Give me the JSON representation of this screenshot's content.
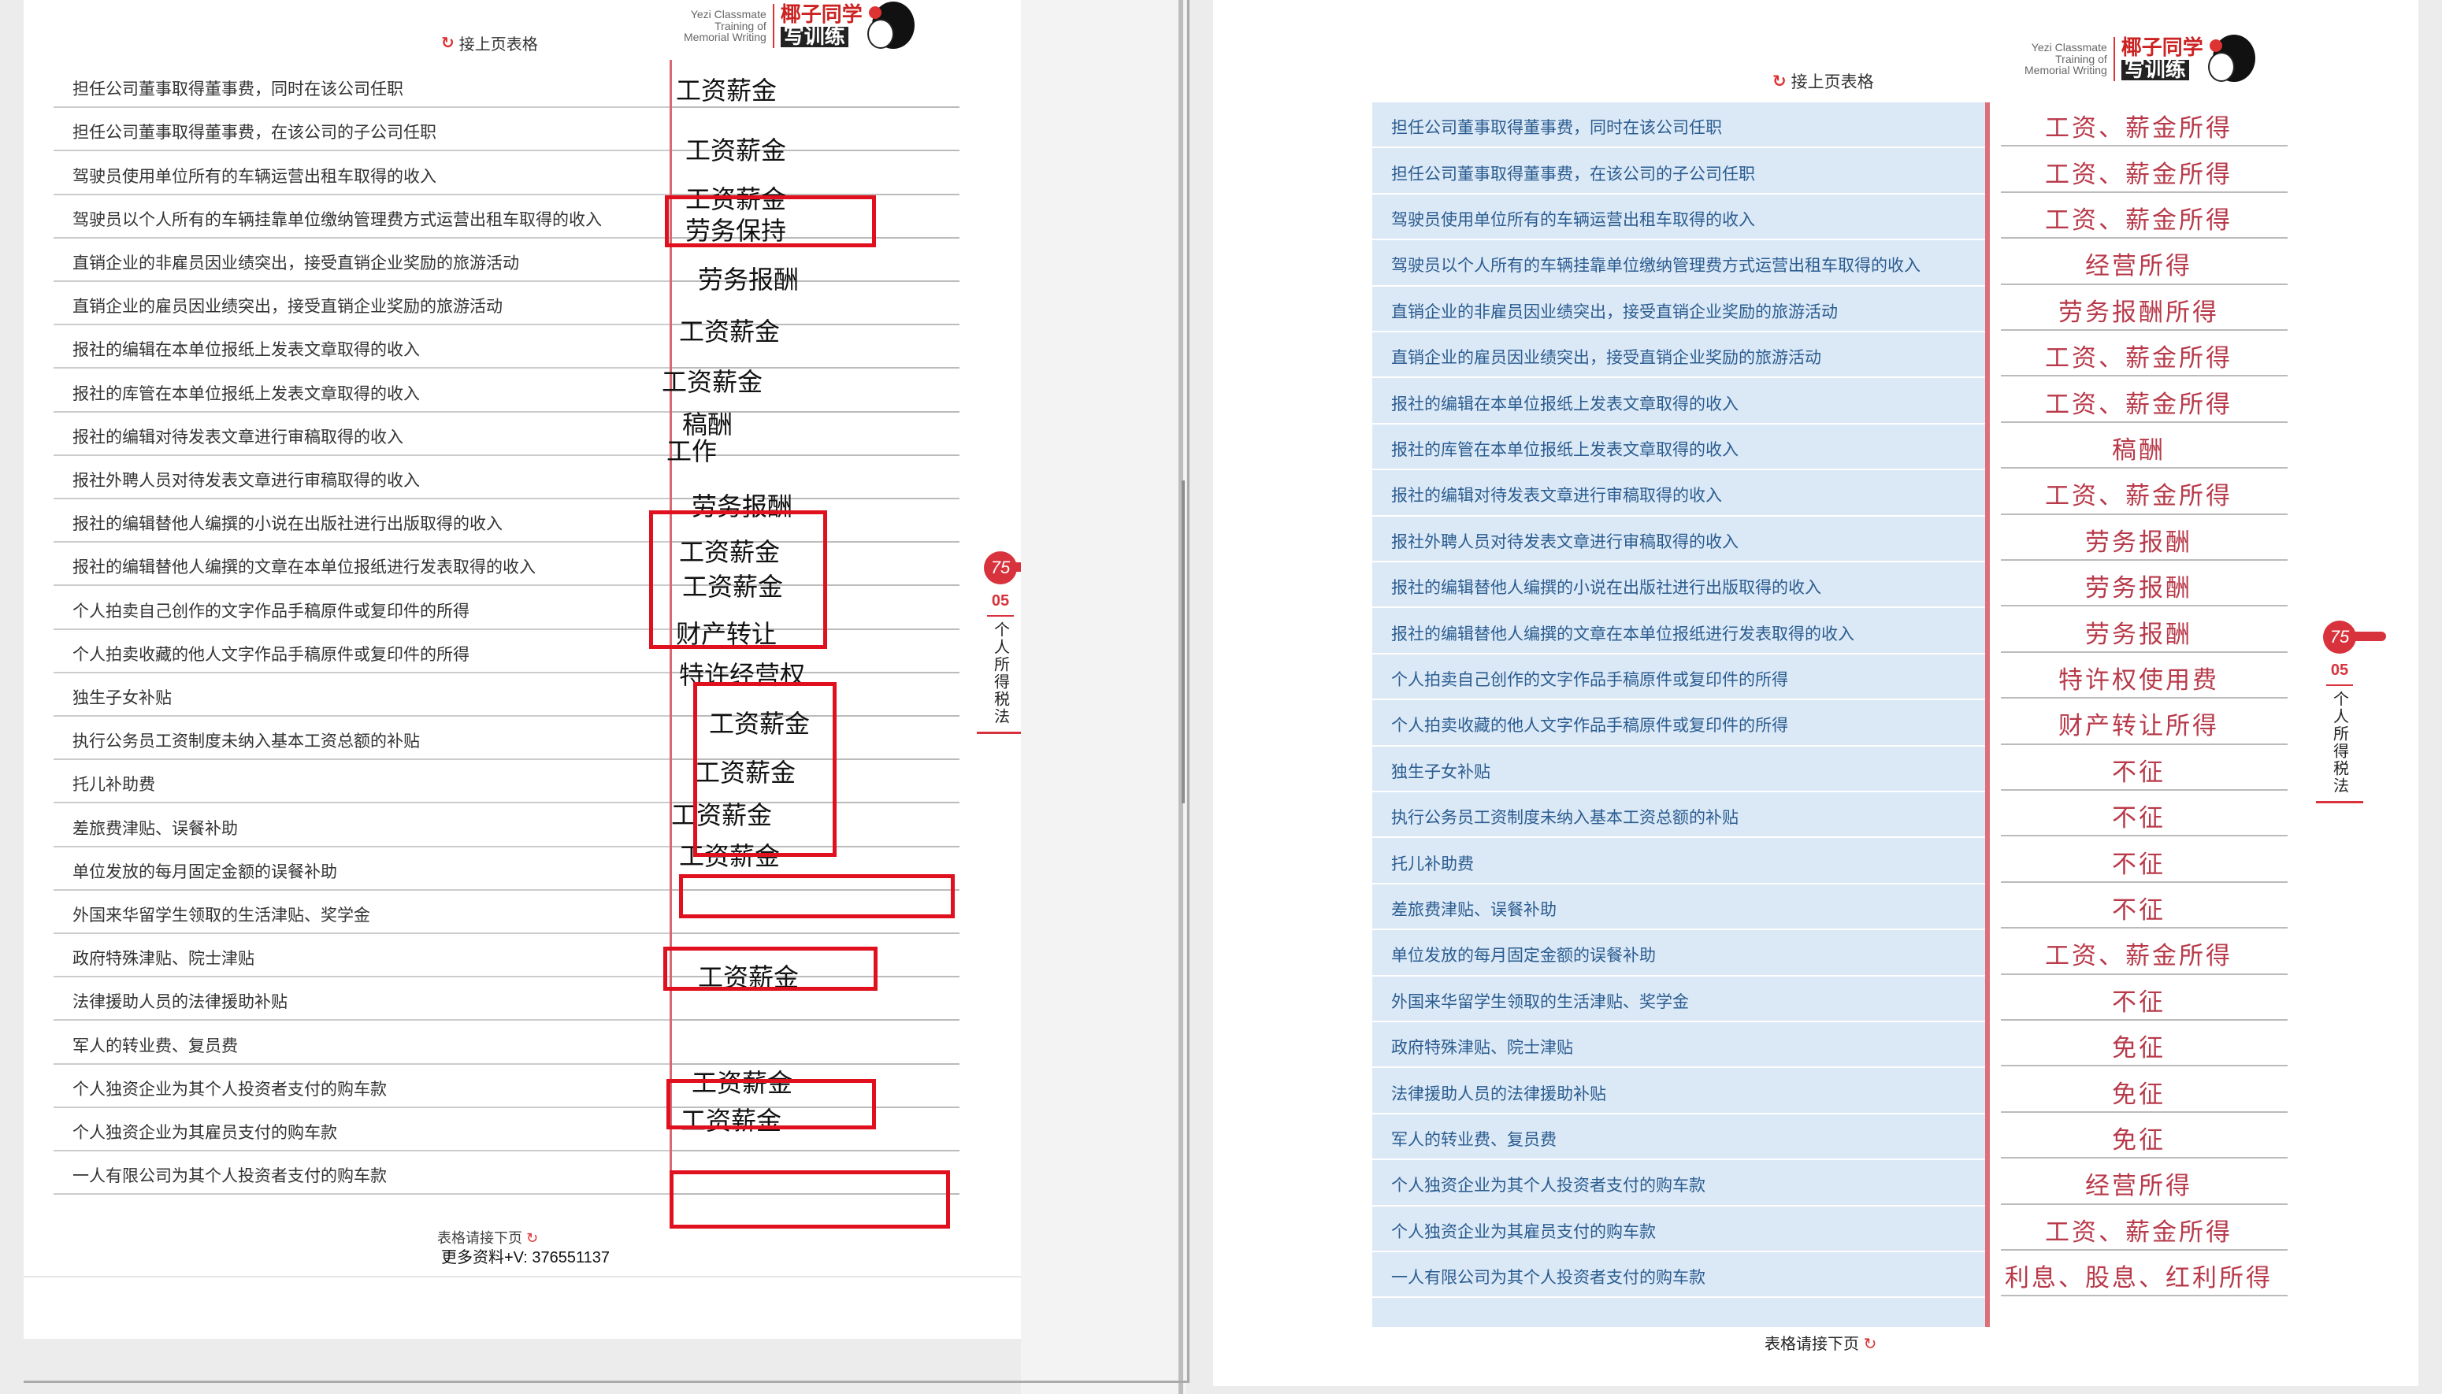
{
  "left": {
    "brand": {
      "en_lines": [
        "Yezi Classmate",
        "Training of",
        "Memorial Writing"
      ],
      "cn_line1": "椰子同学",
      "cn_line2": "写训练"
    },
    "continue_label": "接上页表格",
    "rows": [
      "担任公司董事取得董事费，同时在该公司任职",
      "担任公司董事取得董事费，在该公司的子公司任职",
      "驾驶员使用单位所有的车辆运营出租车取得的收入",
      "驾驶员以个人所有的车辆挂靠单位缴纳管理费方式运营出租车取得的收入",
      "直销企业的非雇员因业绩突出，接受直销企业奖励的旅游活动",
      "直销企业的雇员因业绩突出，接受直销企业奖励的旅游活动",
      "报社的编辑在本单位报纸上发表文章取得的收入",
      "报社的库管在本单位报纸上发表文章取得的收入",
      "报社的编辑对待发表文章进行审稿取得的收入",
      "报社外聘人员对待发表文章进行审稿取得的收入",
      "报社的编辑替他人编撰的小说在出版社进行出版取得的收入",
      "报社的编辑替他人编撰的文章在本单位报纸进行发表取得的收入",
      "个人拍卖自己创作的文字作品手稿原件或复印件的所得",
      "个人拍卖收藏的他人文字作品手稿原件或复印件的所得",
      "独生子女补贴",
      "执行公务员工资制度未纳入基本工资总额的补贴",
      "托儿补助费",
      "差旅费津贴、误餐补助",
      "单位发放的每月固定金额的误餐补助",
      "外国来华留学生领取的生活津贴、奖学金",
      "政府特殊津贴、院士津贴",
      "法律援助人员的法律援助补贴",
      "军人的转业费、复员费",
      "个人独资企业为其个人投资者支付的购车款",
      "个人独资企业为其雇员支付的购车款",
      "一人有限公司为其个人投资者支付的购车款"
    ],
    "answers": [
      "工资薪金",
      "工资薪金",
      "工资薪金",
      "劳务保持",
      "劳务报酬",
      "工资薪金",
      "工资薪金",
      "稿酬",
      "工作",
      "劳务报酬",
      "工资薪金",
      "工资薪金",
      "财产转让",
      "特许经营权",
      "工资薪金",
      "工资薪金",
      "工资薪金",
      "工资薪金",
      "工资薪金",
      "工资薪金",
      "工资薪金"
    ],
    "tab": {
      "page_num": "75",
      "chapter": "05",
      "title": "个人所得税法"
    },
    "footer_next": "表格请接下页",
    "footer_contact": "更多资料+V: 376551137"
  },
  "right": {
    "brand": {
      "en_lines": [
        "Yezi Classmate",
        "Training of",
        "Memorial Writing"
      ],
      "cn_line1": "椰子同学",
      "cn_line2": "写训练"
    },
    "continue_label": "接上页表格",
    "rows": [
      {
        "desc": "担任公司董事取得董事费，同时在该公司任职",
        "answer": "工资、薪金所得"
      },
      {
        "desc": "担任公司董事取得董事费，在该公司的子公司任职",
        "answer": "工资、薪金所得"
      },
      {
        "desc": "驾驶员使用单位所有的车辆运营出租车取得的收入",
        "answer": "工资、薪金所得"
      },
      {
        "desc": "驾驶员以个人所有的车辆挂靠单位缴纳管理费方式运营出租车取得的收入",
        "answer": "经营所得"
      },
      {
        "desc": "直销企业的非雇员因业绩突出，接受直销企业奖励的旅游活动",
        "answer": "劳务报酬所得"
      },
      {
        "desc": "直销企业的雇员因业绩突出，接受直销企业奖励的旅游活动",
        "answer": "工资、薪金所得"
      },
      {
        "desc": "报社的编辑在本单位报纸上发表文章取得的收入",
        "answer": "工资、薪金所得"
      },
      {
        "desc": "报社的库管在本单位报纸上发表文章取得的收入",
        "answer": "稿酬"
      },
      {
        "desc": "报社的编辑对待发表文章进行审稿取得的收入",
        "answer": "工资、薪金所得"
      },
      {
        "desc": "报社外聘人员对待发表文章进行审稿取得的收入",
        "answer": "劳务报酬"
      },
      {
        "desc": "报社的编辑替他人编撰的小说在出版社进行出版取得的收入",
        "answer": "劳务报酬"
      },
      {
        "desc": "报社的编辑替他人编撰的文章在本单位报纸进行发表取得的收入",
        "answer": "劳务报酬"
      },
      {
        "desc": "个人拍卖自己创作的文字作品手稿原件或复印件的所得",
        "answer": "特许权使用费"
      },
      {
        "desc": "个人拍卖收藏的他人文字作品手稿原件或复印件的所得",
        "answer": "财产转让所得"
      },
      {
        "desc": "独生子女补贴",
        "answer": "不征"
      },
      {
        "desc": "执行公务员工资制度未纳入基本工资总额的补贴",
        "answer": "不征"
      },
      {
        "desc": "托儿补助费",
        "answer": "不征"
      },
      {
        "desc": "差旅费津贴、误餐补助",
        "answer": "不征"
      },
      {
        "desc": "单位发放的每月固定金额的误餐补助",
        "answer": "工资、薪金所得"
      },
      {
        "desc": "外国来华留学生领取的生活津贴、奖学金",
        "answer": "不征"
      },
      {
        "desc": "政府特殊津贴、院士津贴",
        "answer": "免征"
      },
      {
        "desc": "法律援助人员的法律援助补贴",
        "answer": "免征"
      },
      {
        "desc": "军人的转业费、复员费",
        "answer": "免征"
      },
      {
        "desc": "个人独资企业为其个人投资者支付的购车款",
        "answer": "经营所得"
      },
      {
        "desc": "个人独资企业为其雇员支付的购车款",
        "answer": "工资、薪金所得"
      },
      {
        "desc": "一人有限公司为其个人投资者支付的购车款",
        "answer": "利息、股息、红利所得"
      }
    ],
    "tab": {
      "page_num": "75",
      "chapter": "05",
      "title": "个人所得税法"
    },
    "footer_next": "表格请接下页"
  },
  "colors": {
    "accent_red": "#d8323c",
    "annotation_red": "#e0101e",
    "table_blue": "#dbe9f7",
    "row_text_blue": "#2b5c8f",
    "answer_pink": "#b83a4a"
  }
}
